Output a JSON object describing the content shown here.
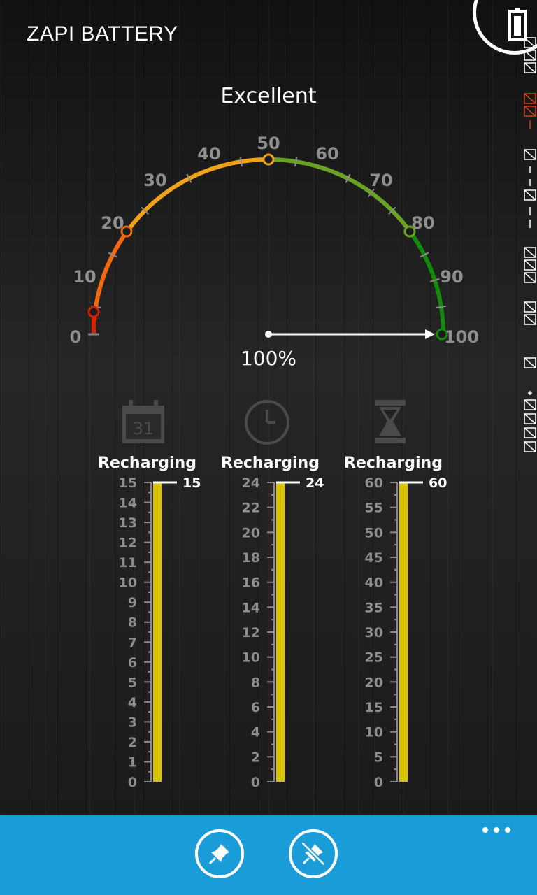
{
  "app": {
    "title": "ZAPI BATTERY"
  },
  "status": {
    "quality": "Excellent",
    "percent_text": "100%",
    "percent": 100
  },
  "gauge": {
    "labels": [
      "0",
      "10",
      "20",
      "30",
      "40",
      "50",
      "60",
      "70",
      "80",
      "90",
      "100"
    ],
    "colors": {
      "red": "#d81e05",
      "orange": "#f3690f",
      "amber": "#f0a318",
      "lightgreen": "#6aa324",
      "green": "#138a0b"
    }
  },
  "widgets": [
    {
      "icon": "calendar-icon",
      "icon_text": "31",
      "label": "Recharging",
      "max": 15,
      "value": 15,
      "value_text": "15",
      "ticks": [
        "15",
        "14",
        "13",
        "12",
        "11",
        "10",
        "9",
        "8",
        "7",
        "6",
        "5",
        "4",
        "3",
        "2",
        "1",
        "0"
      ]
    },
    {
      "icon": "clock-icon",
      "label": "Recharging",
      "max": 24,
      "value": 24,
      "value_text": "24",
      "ticks": [
        "24",
        "22",
        "20",
        "18",
        "16",
        "14",
        "12",
        "10",
        "8",
        "6",
        "4",
        "2",
        "0"
      ]
    },
    {
      "icon": "hourglass-icon",
      "label": "Recharging",
      "max": 60,
      "value": 60,
      "value_text": "60",
      "ticks": [
        "60",
        "55",
        "50",
        "45",
        "40",
        "35",
        "30",
        "25",
        "20",
        "15",
        "10",
        "5",
        "0"
      ]
    }
  ],
  "colors": {
    "bar": "#d9c300",
    "appbar": "#1a9cd9",
    "tick": "#8a8a8a"
  },
  "appbar": {
    "buttons": [
      "pin-icon",
      "unpin-icon"
    ],
    "more": "ellipsis-icon"
  }
}
